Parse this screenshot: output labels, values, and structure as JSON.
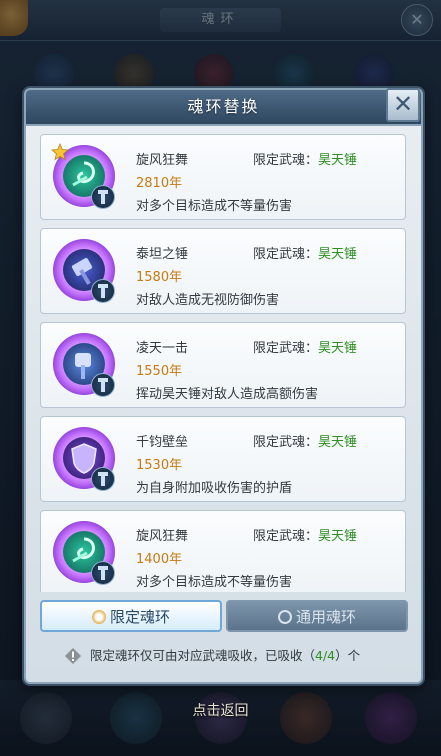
{
  "background": {
    "title": "魂环"
  },
  "dialog": {
    "title": "魂环替换",
    "close_label": "✕"
  },
  "limit_label": "限定武魂：",
  "rings": [
    {
      "name": "旋风狂舞",
      "limit_value": "昊天锤",
      "year": "2810年",
      "effect": "对多个目标造成不等量伤害",
      "icon": "whirlwind-icon",
      "starred": true
    },
    {
      "name": "泰坦之锤",
      "limit_value": "昊天锤",
      "year": "1580年",
      "effect": "对敌人造成无视防御伤害",
      "icon": "hammer-icon",
      "starred": false
    },
    {
      "name": "凌天一击",
      "limit_value": "昊天锤",
      "year": "1550年",
      "effect": "挥动昊天锤对敌人造成高额伤害",
      "icon": "hammer-strike-icon",
      "starred": false
    },
    {
      "name": "千钧壁垒",
      "limit_value": "昊天锤",
      "year": "1530年",
      "effect": "为自身附加吸收伤害的护盾",
      "icon": "shield-icon",
      "starred": false
    },
    {
      "name": "旋风狂舞",
      "limit_value": "昊天锤",
      "year": "1400年",
      "effect": "对多个目标造成不等量伤害",
      "icon": "whirlwind-icon",
      "starred": false
    }
  ],
  "tabs": {
    "limited": "限定魂环",
    "general": "通用魂环"
  },
  "notice": {
    "text": "限定魂环仅可由对应武魂吸收，已吸收（",
    "count": "4/4",
    "suffix": "）个"
  },
  "footer": {
    "hint": "点击返回"
  },
  "colors": {
    "year": "#c77a12",
    "limit_value": "#2f8f23",
    "header": "#3f5a75"
  }
}
